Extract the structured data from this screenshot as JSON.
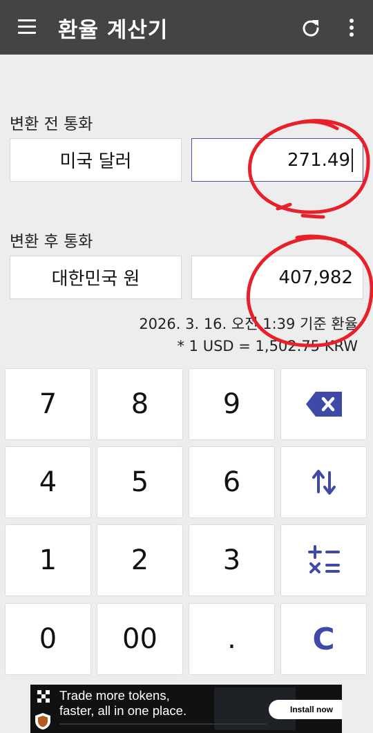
{
  "app_bar": {
    "title": "환율 계산기",
    "icons": {
      "menu": "menu-icon",
      "refresh": "refresh-icon",
      "more": "more-vert-icon"
    }
  },
  "from_section": {
    "label": "변환 전 통화",
    "currency": "미국 달러",
    "amount": "271.49"
  },
  "to_section": {
    "label": "변환 후 통화",
    "currency": "대한민국 원",
    "amount": "407,982"
  },
  "rate_info": {
    "date_line": "2026. 3. 16. 오전 1:39 기준 환율",
    "rate_line": "* 1 USD = 1,502.75 KRW"
  },
  "keypad": {
    "keys": [
      "7",
      "8",
      "9",
      "4",
      "5",
      "6",
      "1",
      "2",
      "3",
      "0",
      "00",
      "."
    ],
    "actions": {
      "backspace": "backspace-icon",
      "swap": "swap-icon",
      "operations": "calculator-ops-icon",
      "clear": "C"
    }
  },
  "ad_banner": {
    "headline_1": "Trade more tokens,",
    "headline_2": "faster, all in one place.",
    "install_label": "Install now"
  },
  "colors": {
    "app_bar": "#444444",
    "background": "#ededed",
    "accent": "#3f4aa8",
    "annotation": "#e8202a"
  }
}
